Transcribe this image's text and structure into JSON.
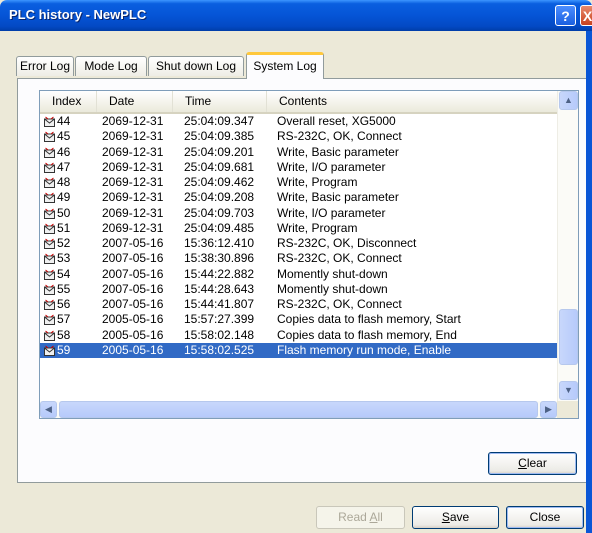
{
  "window": {
    "title": "PLC history - NewPLC",
    "help_label": "?",
    "close_label": "X"
  },
  "tabs": [
    {
      "label": "Error Log",
      "active": false
    },
    {
      "label": "Mode Log",
      "active": false
    },
    {
      "label": "Shut down Log",
      "active": false
    },
    {
      "label": "System Log",
      "active": true
    }
  ],
  "log_table": {
    "columns": [
      "Index",
      "Date",
      "Time",
      "Contents"
    ],
    "rows": [
      {
        "index": "44",
        "date": "2069-12-31",
        "time": "25:04:09.347",
        "contents": "Overall reset, XG5000"
      },
      {
        "index": "45",
        "date": "2069-12-31",
        "time": "25:04:09.385",
        "contents": "RS-232C, OK, Connect"
      },
      {
        "index": "46",
        "date": "2069-12-31",
        "time": "25:04:09.201",
        "contents": "Write, Basic parameter"
      },
      {
        "index": "47",
        "date": "2069-12-31",
        "time": "25:04:09.681",
        "contents": "Write, I/O parameter"
      },
      {
        "index": "48",
        "date": "2069-12-31",
        "time": "25:04:09.462",
        "contents": "Write, Program"
      },
      {
        "index": "49",
        "date": "2069-12-31",
        "time": "25:04:09.208",
        "contents": "Write, Basic parameter"
      },
      {
        "index": "50",
        "date": "2069-12-31",
        "time": "25:04:09.703",
        "contents": "Write, I/O parameter"
      },
      {
        "index": "51",
        "date": "2069-12-31",
        "time": "25:04:09.485",
        "contents": "Write, Program"
      },
      {
        "index": "52",
        "date": "2007-05-16",
        "time": "15:36:12.410",
        "contents": "RS-232C, OK, Disconnect"
      },
      {
        "index": "53",
        "date": "2007-05-16",
        "time": "15:38:30.896",
        "contents": "RS-232C, OK, Connect"
      },
      {
        "index": "54",
        "date": "2007-05-16",
        "time": "15:44:22.882",
        "contents": "Momently shut-down"
      },
      {
        "index": "55",
        "date": "2007-05-16",
        "time": "15:44:28.643",
        "contents": "Momently shut-down"
      },
      {
        "index": "56",
        "date": "2007-05-16",
        "time": "15:44:41.807",
        "contents": "RS-232C, OK, Connect"
      },
      {
        "index": "57",
        "date": "2005-05-16",
        "time": "15:57:27.399",
        "contents": "Copies data to flash memory, Start"
      },
      {
        "index": "58",
        "date": "2005-05-16",
        "time": "15:58:02.148",
        "contents": "Copies data to flash memory, End"
      },
      {
        "index": "59",
        "date": "2005-05-16",
        "time": "15:58:02.525",
        "contents": "Flash memory run mode, Enable",
        "selected": true
      }
    ],
    "row_icon": "log-entry-icon"
  },
  "buttons": {
    "clear": {
      "mnemonic": "C",
      "rest": "lear"
    },
    "read_all": {
      "prefix": "Read ",
      "mnemonic": "A",
      "rest": "ll",
      "disabled": true
    },
    "save": {
      "mnemonic": "S",
      "rest": "ave"
    },
    "close": "Close"
  },
  "colors": {
    "title_bar": "#0554d6",
    "selection": "#316ac5",
    "active_tab_highlight": "#ffc83c"
  }
}
